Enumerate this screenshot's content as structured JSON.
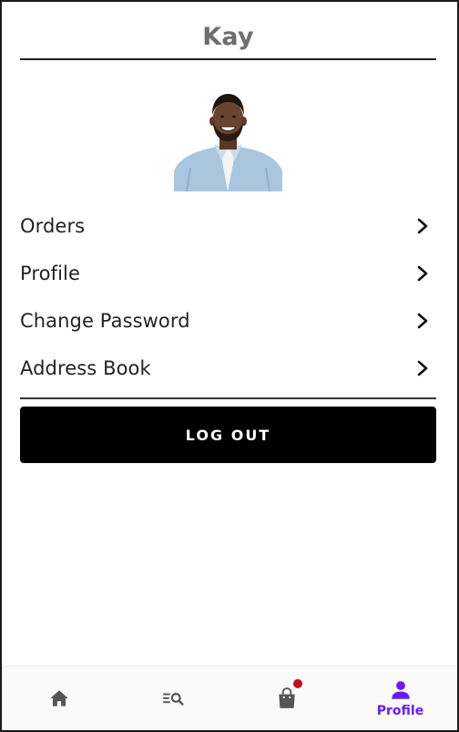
{
  "header": {
    "title": "Kay"
  },
  "avatar": {
    "icon": "user-photo"
  },
  "menu": {
    "items": [
      {
        "label": "Orders",
        "icon": "chevron-right-icon"
      },
      {
        "label": "Profile",
        "icon": "chevron-right-icon"
      },
      {
        "label": "Change Password",
        "icon": "chevron-right-icon"
      },
      {
        "label": "Address Book",
        "icon": "chevron-right-icon"
      }
    ]
  },
  "logout": {
    "label": "LOG OUT"
  },
  "bottom_nav": {
    "items": [
      {
        "icon": "home-icon",
        "label": "",
        "active": false
      },
      {
        "icon": "search-list-icon",
        "label": "",
        "active": false
      },
      {
        "icon": "shopping-bag-icon",
        "label": "",
        "active": false,
        "badge": true
      },
      {
        "icon": "person-icon",
        "label": "Profile",
        "active": true
      }
    ]
  },
  "colors": {
    "accent": "#6a1bff",
    "badge": "#c20d1e",
    "button_bg": "#000000",
    "title": "#6e6e6e",
    "nav_icon": "#555555"
  }
}
